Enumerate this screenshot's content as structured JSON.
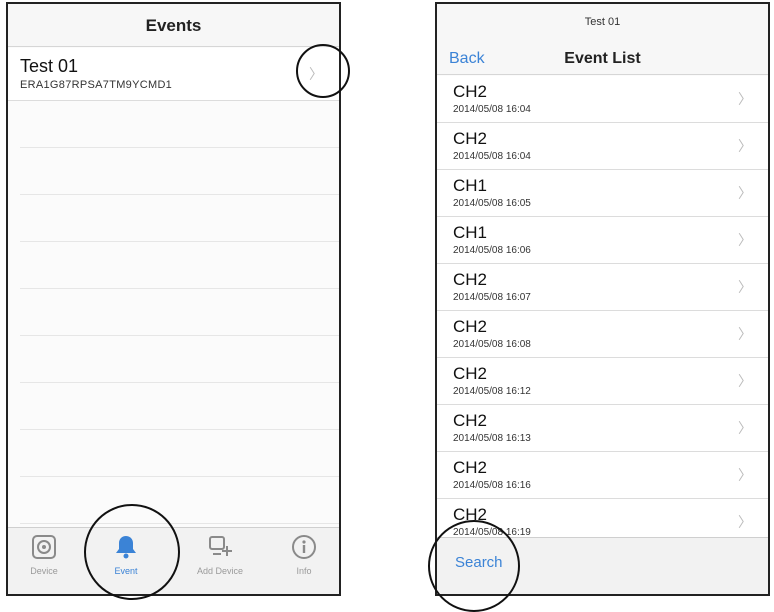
{
  "left": {
    "nav": {
      "title": "Events"
    },
    "device": {
      "name": "Test 01",
      "serial": "ERA1G87RPSA7TM9YCMD1"
    },
    "tabs": [
      {
        "label": "Device",
        "icon": "device-icon"
      },
      {
        "label": "Event",
        "icon": "bell-icon"
      },
      {
        "label": "Add Device",
        "icon": "add-device-icon"
      },
      {
        "label": "Info",
        "icon": "info-icon"
      }
    ]
  },
  "right": {
    "nav": {
      "subtitle": "Test 01",
      "back_label": "Back",
      "title": "Event List"
    },
    "events": [
      {
        "channel": "CH2",
        "time": "2014/05/08 16:04"
      },
      {
        "channel": "CH2",
        "time": "2014/05/08 16:04"
      },
      {
        "channel": "CH1",
        "time": "2014/05/08 16:05"
      },
      {
        "channel": "CH1",
        "time": "2014/05/08 16:06"
      },
      {
        "channel": "CH2",
        "time": "2014/05/08 16:07"
      },
      {
        "channel": "CH2",
        "time": "2014/05/08 16:08"
      },
      {
        "channel": "CH2",
        "time": "2014/05/08 16:12"
      },
      {
        "channel": "CH2",
        "time": "2014/05/08 16:13"
      },
      {
        "channel": "CH2",
        "time": "2014/05/08 16:16"
      },
      {
        "channel": "CH2",
        "time": "2014/05/08 16:19"
      }
    ],
    "bottom": {
      "search_label": "Search"
    }
  },
  "colors": {
    "accent": "#3b83d6",
    "chevron": "#bbbbbb"
  }
}
